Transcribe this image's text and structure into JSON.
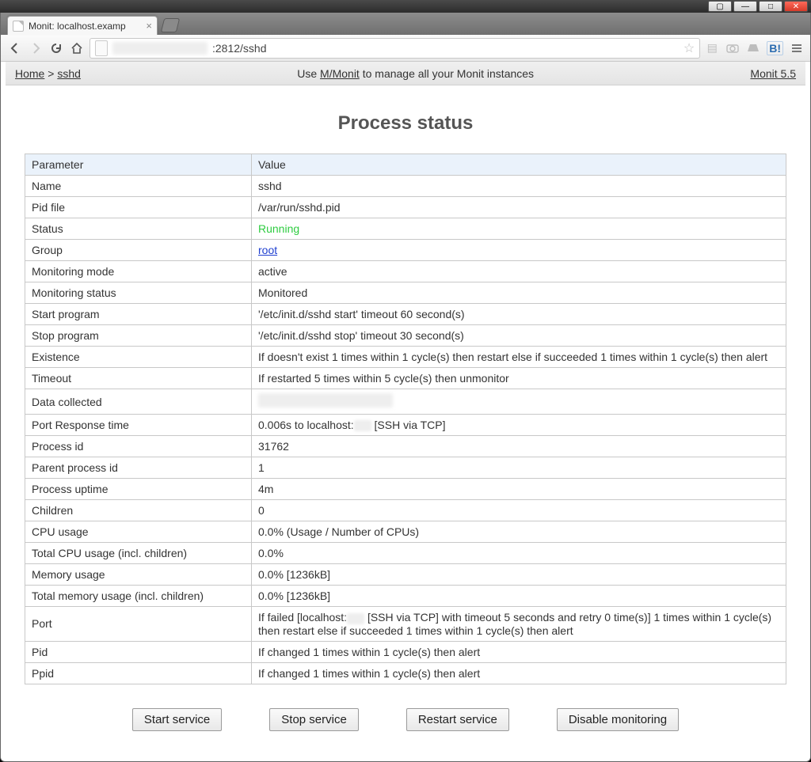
{
  "os": {
    "minimize_tip": "Minimize",
    "maximize_tip": "Maximize",
    "close_tip": "Close"
  },
  "browser": {
    "tab_title": "Monit: localhost.examp",
    "url_suffix": ":2812/sshd",
    "hatena_label": "B!"
  },
  "topbar": {
    "home": "Home",
    "sep": " > ",
    "crumb": "sshd",
    "promo_prefix": "Use ",
    "promo_link": "M/Monit",
    "promo_suffix": " to manage all your Monit instances",
    "version": "Monit 5.5"
  },
  "title": "Process status",
  "table": {
    "head_param": "Parameter",
    "head_value": "Value",
    "rows": [
      {
        "k": "Name",
        "v": "sshd"
      },
      {
        "k": "Pid file",
        "v": "/var/run/sshd.pid"
      },
      {
        "k": "Status",
        "v": "Running",
        "style": "green"
      },
      {
        "k": "Group",
        "v": "root",
        "style": "link"
      },
      {
        "k": "Monitoring mode",
        "v": "active"
      },
      {
        "k": "Monitoring status",
        "v": "Monitored"
      },
      {
        "k": "Start program",
        "v": "'/etc/init.d/sshd start' timeout 60 second(s)"
      },
      {
        "k": "Stop program",
        "v": "'/etc/init.d/sshd stop' timeout 30 second(s)"
      },
      {
        "k": "Existence",
        "v": "If doesn't exist 1 times within 1 cycle(s) then restart else if succeeded 1 times within 1 cycle(s) then alert"
      },
      {
        "k": "Timeout",
        "v": "If restarted 5 times within 5 cycle(s) then unmonitor"
      },
      {
        "k": "Data collected",
        "style": "row-blur"
      },
      {
        "k": "Port Response time",
        "pre": "0.006s to localhost:",
        "blur": true,
        "post": " [SSH via TCP]"
      },
      {
        "k": "Process id",
        "v": "31762"
      },
      {
        "k": "Parent process id",
        "v": "1"
      },
      {
        "k": "Process uptime",
        "v": "4m"
      },
      {
        "k": "Children",
        "v": "0"
      },
      {
        "k": "CPU usage",
        "v": "0.0%   (Usage / Number of CPUs)"
      },
      {
        "k": "Total CPU usage (incl. children)",
        "v": "0.0%"
      },
      {
        "k": "Memory usage",
        "v": "0.0% [1236kB]"
      },
      {
        "k": "Total memory usage (incl. children)",
        "v": "0.0% [1236kB]"
      },
      {
        "k": "Port",
        "pre": "If failed [localhost:",
        "blur": true,
        "post": " [SSH via TCP] with timeout 5 seconds and retry 0 time(s)] 1 times within 1 cycle(s) then restart else if succeeded 1 times within 1 cycle(s) then alert"
      },
      {
        "k": "Pid",
        "v": "If changed 1 times within 1 cycle(s) then alert"
      },
      {
        "k": "Ppid",
        "v": "If changed 1 times within 1 cycle(s) then alert"
      }
    ]
  },
  "actions": {
    "start": "Start service",
    "stop": "Stop service",
    "restart": "Restart service",
    "disable": "Disable monitoring"
  }
}
